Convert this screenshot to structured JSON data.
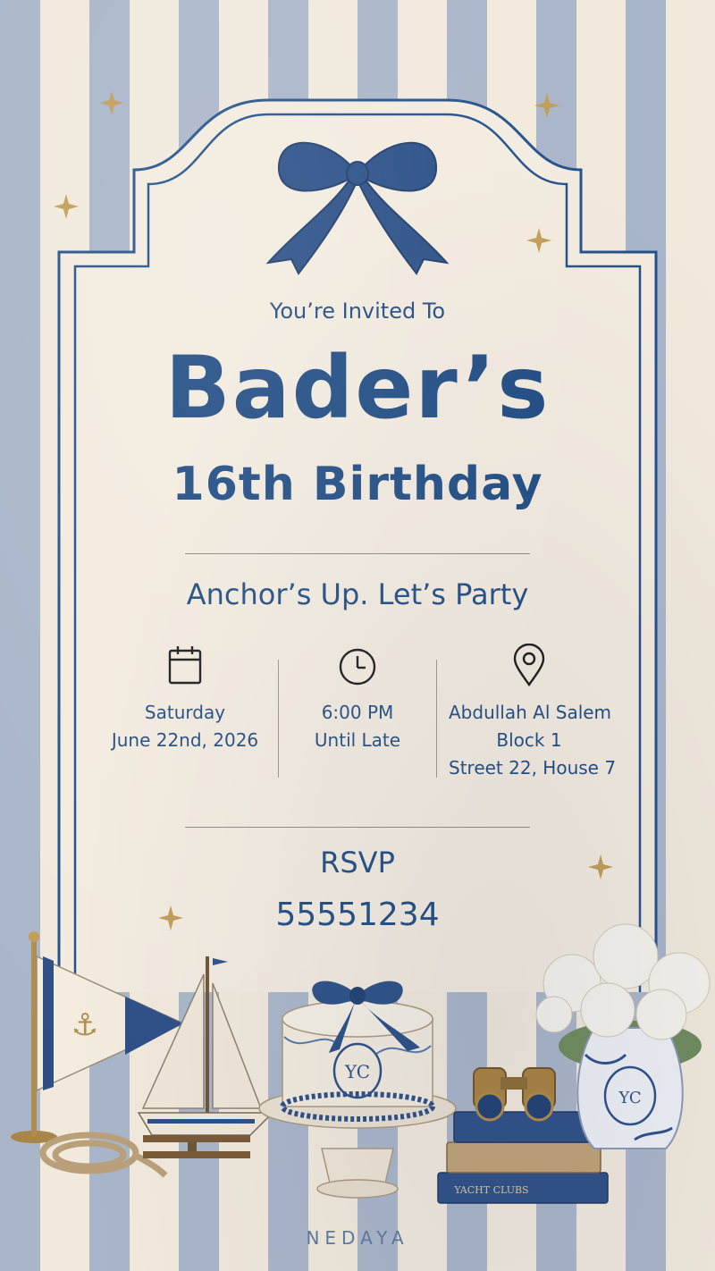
{
  "invitation": {
    "subtitle": "You’re Invited To",
    "name": "Bader’s",
    "occasion": "16th Birthday",
    "tagline": "Anchor’s Up. Let’s Party"
  },
  "details": {
    "date": {
      "icon": "calendar-icon",
      "line1": "Saturday",
      "line2": "June 22nd, 2026"
    },
    "time": {
      "icon": "clock-icon",
      "line1": "6:00 PM",
      "line2": "Until Late"
    },
    "location": {
      "icon": "location-pin-icon",
      "line1": "Abdullah Al Salem",
      "line2": "Block 1",
      "line3": "Street 22, House 7"
    }
  },
  "rsvp": {
    "label": "RSVP",
    "number": "55551234"
  },
  "brand": "NEDAYA",
  "colors": {
    "navy": "#1f4b82",
    "cream": "#f1e9dc",
    "stripe": "#a9b5c9",
    "gold": "#b89a55"
  }
}
